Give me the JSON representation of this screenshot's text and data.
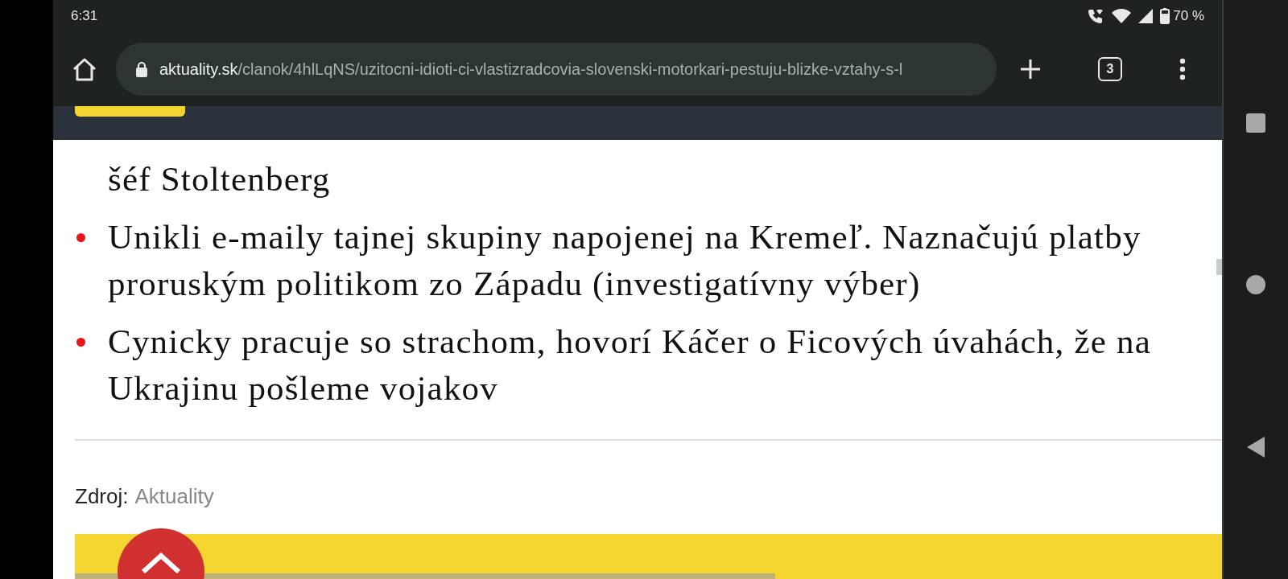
{
  "status_bar": {
    "time": "6:31",
    "battery": "70 %",
    "level": 0.7
  },
  "browser": {
    "url_host": "aktuality.sk",
    "url_path": "/clanok/4hlLqNS/uzitocni-idioti-ci-vlastizradcovia-slovenski-motorkari-pestuju-blizke-vztahy-s-l",
    "tab_count": "3"
  },
  "article": {
    "links": [
      {
        "kind": "continuation",
        "text": "šéf Stoltenberg"
      },
      {
        "kind": "item",
        "text": "Unikli e-maily tajnej skupiny napojenej na Kremeľ. Naznačujú platby proruským politikom zo Západu (investigatívny výber)"
      },
      {
        "kind": "item",
        "text": "Cynicky pracuje so strachom, hovorí Káčer o Ficových úvahách, že na Ukrajinu pošleme vojakov"
      }
    ],
    "source": {
      "label": "Zdroj:",
      "link": "Aktuality"
    }
  }
}
